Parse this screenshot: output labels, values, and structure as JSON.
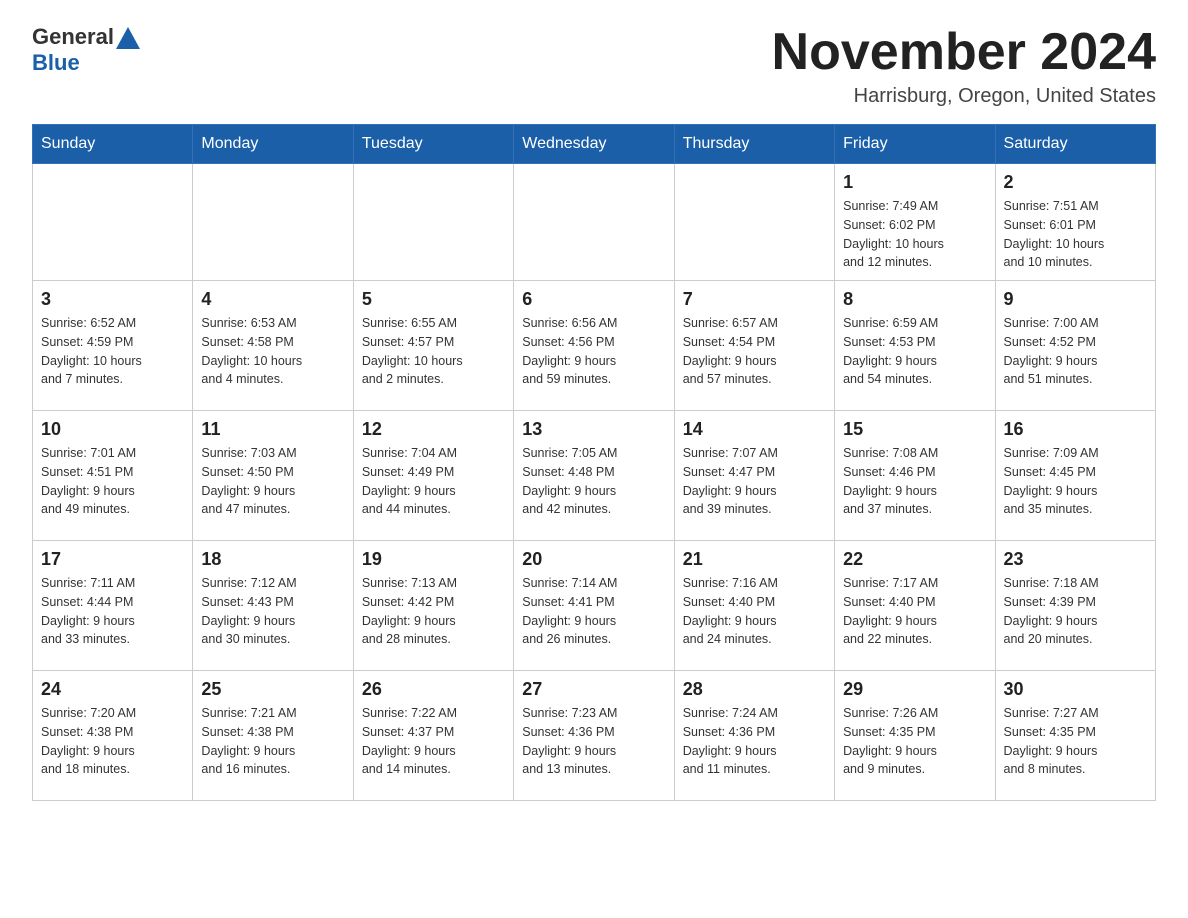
{
  "header": {
    "logo_general": "General",
    "logo_blue": "Blue",
    "title": "November 2024",
    "subtitle": "Harrisburg, Oregon, United States"
  },
  "weekdays": [
    "Sunday",
    "Monday",
    "Tuesday",
    "Wednesday",
    "Thursday",
    "Friday",
    "Saturday"
  ],
  "weeks": [
    [
      {
        "day": "",
        "info": ""
      },
      {
        "day": "",
        "info": ""
      },
      {
        "day": "",
        "info": ""
      },
      {
        "day": "",
        "info": ""
      },
      {
        "day": "",
        "info": ""
      },
      {
        "day": "1",
        "info": "Sunrise: 7:49 AM\nSunset: 6:02 PM\nDaylight: 10 hours\nand 12 minutes."
      },
      {
        "day": "2",
        "info": "Sunrise: 7:51 AM\nSunset: 6:01 PM\nDaylight: 10 hours\nand 10 minutes."
      }
    ],
    [
      {
        "day": "3",
        "info": "Sunrise: 6:52 AM\nSunset: 4:59 PM\nDaylight: 10 hours\nand 7 minutes."
      },
      {
        "day": "4",
        "info": "Sunrise: 6:53 AM\nSunset: 4:58 PM\nDaylight: 10 hours\nand 4 minutes."
      },
      {
        "day": "5",
        "info": "Sunrise: 6:55 AM\nSunset: 4:57 PM\nDaylight: 10 hours\nand 2 minutes."
      },
      {
        "day": "6",
        "info": "Sunrise: 6:56 AM\nSunset: 4:56 PM\nDaylight: 9 hours\nand 59 minutes."
      },
      {
        "day": "7",
        "info": "Sunrise: 6:57 AM\nSunset: 4:54 PM\nDaylight: 9 hours\nand 57 minutes."
      },
      {
        "day": "8",
        "info": "Sunrise: 6:59 AM\nSunset: 4:53 PM\nDaylight: 9 hours\nand 54 minutes."
      },
      {
        "day": "9",
        "info": "Sunrise: 7:00 AM\nSunset: 4:52 PM\nDaylight: 9 hours\nand 51 minutes."
      }
    ],
    [
      {
        "day": "10",
        "info": "Sunrise: 7:01 AM\nSunset: 4:51 PM\nDaylight: 9 hours\nand 49 minutes."
      },
      {
        "day": "11",
        "info": "Sunrise: 7:03 AM\nSunset: 4:50 PM\nDaylight: 9 hours\nand 47 minutes."
      },
      {
        "day": "12",
        "info": "Sunrise: 7:04 AM\nSunset: 4:49 PM\nDaylight: 9 hours\nand 44 minutes."
      },
      {
        "day": "13",
        "info": "Sunrise: 7:05 AM\nSunset: 4:48 PM\nDaylight: 9 hours\nand 42 minutes."
      },
      {
        "day": "14",
        "info": "Sunrise: 7:07 AM\nSunset: 4:47 PM\nDaylight: 9 hours\nand 39 minutes."
      },
      {
        "day": "15",
        "info": "Sunrise: 7:08 AM\nSunset: 4:46 PM\nDaylight: 9 hours\nand 37 minutes."
      },
      {
        "day": "16",
        "info": "Sunrise: 7:09 AM\nSunset: 4:45 PM\nDaylight: 9 hours\nand 35 minutes."
      }
    ],
    [
      {
        "day": "17",
        "info": "Sunrise: 7:11 AM\nSunset: 4:44 PM\nDaylight: 9 hours\nand 33 minutes."
      },
      {
        "day": "18",
        "info": "Sunrise: 7:12 AM\nSunset: 4:43 PM\nDaylight: 9 hours\nand 30 minutes."
      },
      {
        "day": "19",
        "info": "Sunrise: 7:13 AM\nSunset: 4:42 PM\nDaylight: 9 hours\nand 28 minutes."
      },
      {
        "day": "20",
        "info": "Sunrise: 7:14 AM\nSunset: 4:41 PM\nDaylight: 9 hours\nand 26 minutes."
      },
      {
        "day": "21",
        "info": "Sunrise: 7:16 AM\nSunset: 4:40 PM\nDaylight: 9 hours\nand 24 minutes."
      },
      {
        "day": "22",
        "info": "Sunrise: 7:17 AM\nSunset: 4:40 PM\nDaylight: 9 hours\nand 22 minutes."
      },
      {
        "day": "23",
        "info": "Sunrise: 7:18 AM\nSunset: 4:39 PM\nDaylight: 9 hours\nand 20 minutes."
      }
    ],
    [
      {
        "day": "24",
        "info": "Sunrise: 7:20 AM\nSunset: 4:38 PM\nDaylight: 9 hours\nand 18 minutes."
      },
      {
        "day": "25",
        "info": "Sunrise: 7:21 AM\nSunset: 4:38 PM\nDaylight: 9 hours\nand 16 minutes."
      },
      {
        "day": "26",
        "info": "Sunrise: 7:22 AM\nSunset: 4:37 PM\nDaylight: 9 hours\nand 14 minutes."
      },
      {
        "day": "27",
        "info": "Sunrise: 7:23 AM\nSunset: 4:36 PM\nDaylight: 9 hours\nand 13 minutes."
      },
      {
        "day": "28",
        "info": "Sunrise: 7:24 AM\nSunset: 4:36 PM\nDaylight: 9 hours\nand 11 minutes."
      },
      {
        "day": "29",
        "info": "Sunrise: 7:26 AM\nSunset: 4:35 PM\nDaylight: 9 hours\nand 9 minutes."
      },
      {
        "day": "30",
        "info": "Sunrise: 7:27 AM\nSunset: 4:35 PM\nDaylight: 9 hours\nand 8 minutes."
      }
    ]
  ]
}
